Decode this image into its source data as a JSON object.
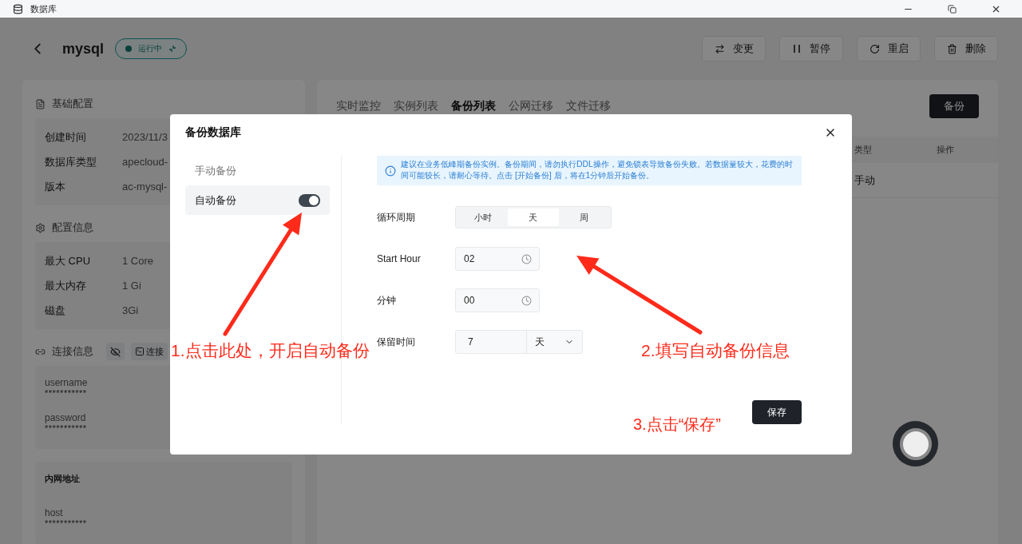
{
  "window": {
    "title": "数据库"
  },
  "header": {
    "name": "mysql",
    "status": "运行中",
    "actions": [
      {
        "label": "变更"
      },
      {
        "label": "暂停"
      },
      {
        "label": "重启"
      },
      {
        "label": "删除"
      }
    ]
  },
  "left_panel": {
    "sections": [
      {
        "title": "基础配置",
        "rows": [
          {
            "label": "创建时间",
            "value": "2023/11/3"
          },
          {
            "label": "数据库类型",
            "value": "apecloud-"
          },
          {
            "label": "版本",
            "value": "ac-mysql-"
          }
        ]
      },
      {
        "title": "配置信息",
        "rows": [
          {
            "label": "最大 CPU",
            "value": "1 Core"
          },
          {
            "label": "最大内存",
            "value": "1 Gi"
          },
          {
            "label": "磁盘",
            "value": "3Gi"
          }
        ]
      }
    ],
    "connection": {
      "title": "连接信息",
      "connect_button": "连接",
      "credentials": [
        {
          "label": "username",
          "value": "***********"
        },
        {
          "label": "password",
          "value": "***********"
        }
      ],
      "intranet": {
        "title": "内网地址",
        "fields": [
          {
            "label": "host",
            "value": "***********"
          }
        ]
      }
    }
  },
  "right_panel": {
    "tabs": [
      {
        "label": "实时监控",
        "selected": false
      },
      {
        "label": "实例列表",
        "selected": false
      },
      {
        "label": "备份列表",
        "selected": true
      },
      {
        "label": "公网迁移",
        "selected": false
      },
      {
        "label": "文件迁移",
        "selected": false
      }
    ],
    "backup_button": "备份",
    "table": {
      "columns": [
        "类型",
        "操作"
      ],
      "rows": [
        [
          "手动"
        ]
      ]
    }
  },
  "modal": {
    "title": "备份数据库",
    "nav": [
      {
        "label": "手动备份",
        "selected": false,
        "kind": "plain"
      },
      {
        "label": "自动备份",
        "selected": true,
        "kind": "switch",
        "on": true
      }
    ],
    "alert": "建议在业务低峰期备份实例。备份期间，请勿执行DDL操作，避免锁表导致备份失败。若数据量较大，花费的时间可能较长，请耐心等待。点击 [开始备份] 后，将在1分钟后开始备份。",
    "period": {
      "label": "循环周期",
      "options": [
        {
          "label": "小时",
          "selected": false
        },
        {
          "label": "天",
          "selected": true
        },
        {
          "label": "周",
          "selected": false
        }
      ]
    },
    "start_hour": {
      "label": "Start Hour",
      "value": "02"
    },
    "minute": {
      "label": "分钟",
      "value": "00"
    },
    "retention": {
      "label": "保留时间",
      "value": "7",
      "unit": "天"
    },
    "save_button": "保存"
  },
  "annotations": [
    {
      "text": "1.点击此处，开启自动备份"
    },
    {
      "text": "2.填写自动备份信息"
    },
    {
      "text": "3.点击“保存”"
    }
  ]
}
